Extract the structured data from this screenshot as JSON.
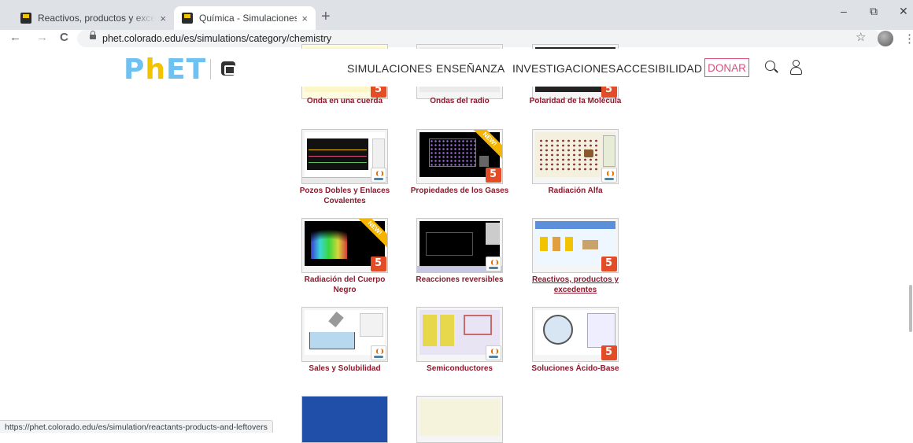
{
  "browser": {
    "tabs": [
      {
        "title": "Reactivos, productos y excedentes",
        "active": false
      },
      {
        "title": "Química - Simulaciones PhET",
        "active": true
      }
    ],
    "close_glyph": "×",
    "new_tab_glyph": "+",
    "url": "phet.colorado.edu/es/simulations/category/chemistry",
    "back_glyph": "←",
    "forward_glyph": "→",
    "reload_glyph": "C",
    "star_glyph": "☆",
    "menu_glyph": "⋮",
    "minimize_glyph": "–",
    "restore_glyph": "⧉",
    "close_window_glyph": "✕",
    "status_url": "https://phet.colorado.edu/es/simulation/reactants-products-and-leftovers"
  },
  "site": {
    "logo": {
      "p": "P",
      "h": "h",
      "e": "E",
      "t": "T"
    },
    "nav": [
      "SIMULACIONES",
      "ENSEÑANZA",
      "INVESTIGACIONES",
      "ACCESIBILIDAD"
    ],
    "donate": "DONAR",
    "accent_color": "#d94f80",
    "title_color": "#8b1a2e"
  },
  "simulations": [
    {
      "title": "Onda en una cuerda",
      "badge": "html5",
      "new": false
    },
    {
      "title": "Ondas del radio",
      "badge": "java",
      "new": false
    },
    {
      "title": "Polaridad de la Molécula",
      "badge": "html5",
      "new": false
    },
    {
      "title": "Pozos Dobles y Enlaces Covalentes",
      "badge": "java",
      "new": false
    },
    {
      "title": "Propiedades de los Gases",
      "badge": "html5",
      "new": true
    },
    {
      "title": "Radiación Alfa",
      "badge": "java",
      "new": false
    },
    {
      "title": "Radiación del Cuerpo Negro",
      "badge": "html5",
      "new": true
    },
    {
      "title": "Reacciones reversibles",
      "badge": "java",
      "new": false
    },
    {
      "title": "Reactivos, productos y excedentes",
      "badge": "html5",
      "new": false
    },
    {
      "title": "Sales y Solubilidad",
      "badge": "java",
      "new": false
    },
    {
      "title": "Semiconductores",
      "badge": "java",
      "new": false
    },
    {
      "title": "Soluciones Ácido-Base",
      "badge": "html5",
      "new": false
    }
  ],
  "new_label": "NEW!"
}
